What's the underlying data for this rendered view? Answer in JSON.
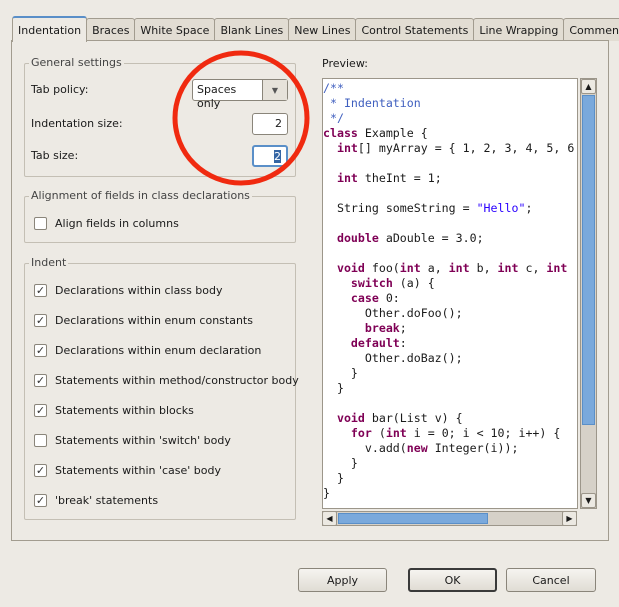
{
  "tabs": [
    "Indentation",
    "Braces",
    "White Space",
    "Blank Lines",
    "New Lines",
    "Control Statements",
    "Line Wrapping",
    "Comments"
  ],
  "active_tab": "Indentation",
  "general": {
    "title": "General settings",
    "tab_policy_label": "Tab policy:",
    "tab_policy_value": "Spaces only",
    "indent_size_label": "Indentation size:",
    "indent_size_value": "2",
    "tab_size_label": "Tab size:",
    "tab_size_value": "2"
  },
  "alignment": {
    "title": "Alignment of fields in class declarations",
    "items": [
      {
        "label": "Align fields in columns",
        "checked": false
      }
    ]
  },
  "indent": {
    "title": "Indent",
    "items": [
      {
        "label": "Declarations within class body",
        "checked": true
      },
      {
        "label": "Declarations within enum constants",
        "checked": true
      },
      {
        "label": "Declarations within enum declaration",
        "checked": true
      },
      {
        "label": "Statements within method/constructor body",
        "checked": true
      },
      {
        "label": "Statements within blocks",
        "checked": true
      },
      {
        "label": "Statements within 'switch' body",
        "checked": false
      },
      {
        "label": "Statements within 'case' body",
        "checked": true
      },
      {
        "label": "'break' statements",
        "checked": true
      }
    ]
  },
  "preview": {
    "label": "Preview:",
    "lines": [
      [
        [
          "/**",
          "cm"
        ]
      ],
      [
        [
          " * Indentation",
          "cm"
        ]
      ],
      [
        [
          " */",
          "cm"
        ]
      ],
      [
        [
          "class",
          "kw"
        ],
        [
          " Example {",
          ""
        ]
      ],
      [
        [
          "  ",
          ""
        ],
        [
          "int",
          "kw"
        ],
        [
          "[] myArray = { 1, 2, 3, 4, 5, 6",
          ""
        ]
      ],
      [],
      [
        [
          "  ",
          ""
        ],
        [
          "int",
          "kw"
        ],
        [
          " theInt = 1;",
          ""
        ]
      ],
      [],
      [
        [
          "  String someString = ",
          ""
        ],
        [
          "\"Hello\"",
          "str"
        ],
        [
          ";",
          ""
        ]
      ],
      [],
      [
        [
          "  ",
          ""
        ],
        [
          "double",
          "kw"
        ],
        [
          " aDouble = 3.0;",
          ""
        ]
      ],
      [],
      [
        [
          "  ",
          ""
        ],
        [
          "void",
          "kw"
        ],
        [
          " foo(",
          ""
        ],
        [
          "int",
          "kw"
        ],
        [
          " a, ",
          ""
        ],
        [
          "int",
          "kw"
        ],
        [
          " b, ",
          ""
        ],
        [
          "int",
          "kw"
        ],
        [
          " c, ",
          ""
        ],
        [
          "int",
          "kw"
        ]
      ],
      [
        [
          "    ",
          ""
        ],
        [
          "switch",
          "kw"
        ],
        [
          " (a) {",
          ""
        ]
      ],
      [
        [
          "    ",
          ""
        ],
        [
          "case",
          "kw"
        ],
        [
          " 0:",
          ""
        ]
      ],
      [
        [
          "      Other.doFoo();",
          ""
        ]
      ],
      [
        [
          "      ",
          ""
        ],
        [
          "break",
          "kw"
        ],
        [
          ";",
          ""
        ]
      ],
      [
        [
          "    ",
          ""
        ],
        [
          "default",
          "kw"
        ],
        [
          ":",
          ""
        ]
      ],
      [
        [
          "      Other.doBaz();",
          ""
        ]
      ],
      [
        [
          "    }",
          ""
        ]
      ],
      [
        [
          "  }",
          ""
        ]
      ],
      [],
      [
        [
          "  ",
          ""
        ],
        [
          "void",
          "kw"
        ],
        [
          " bar(List v) {",
          ""
        ]
      ],
      [
        [
          "    ",
          ""
        ],
        [
          "for",
          "kw"
        ],
        [
          " (",
          ""
        ],
        [
          "int",
          "kw"
        ],
        [
          " i = 0; i < 10; i++) {",
          ""
        ]
      ],
      [
        [
          "      v.add(",
          ""
        ],
        [
          "new",
          "kw"
        ],
        [
          " Integer(i));",
          ""
        ]
      ],
      [
        [
          "    }",
          ""
        ]
      ],
      [
        [
          "  }",
          ""
        ]
      ],
      [
        [
          "}",
          ""
        ]
      ]
    ]
  },
  "buttons": {
    "apply": "Apply",
    "ok": "OK",
    "cancel": "Cancel"
  },
  "colors": {
    "annotation_circle": "#f02a10",
    "accent": "#5a8fc8"
  }
}
